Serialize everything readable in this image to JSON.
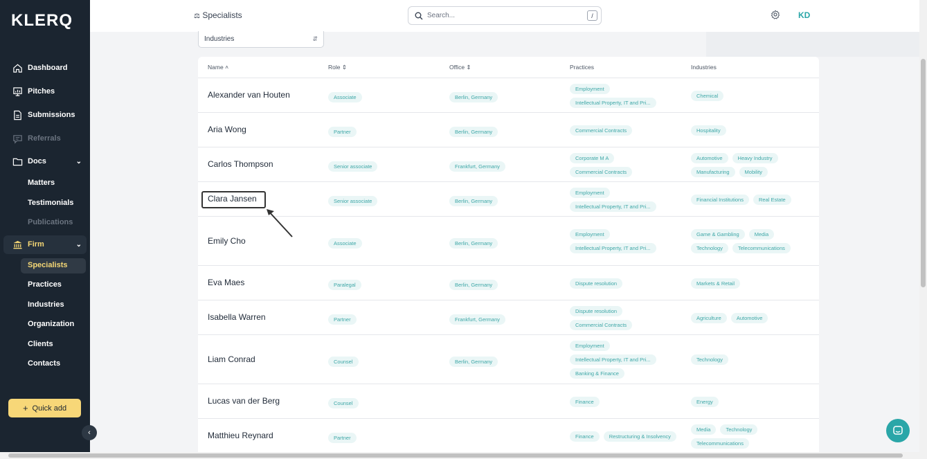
{
  "app": {
    "logo": "KLERQ"
  },
  "sidebar": {
    "items": [
      {
        "label": "Dashboard",
        "icon": "home-icon"
      },
      {
        "label": "Pitches",
        "icon": "presentation-icon"
      },
      {
        "label": "Submissions",
        "icon": "document-icon"
      },
      {
        "label": "Referrals",
        "icon": "chat-icon"
      },
      {
        "label": "Docs",
        "icon": "folder-icon"
      }
    ],
    "docs_sub": [
      "Matters",
      "Testimonials",
      "Publications"
    ],
    "firm_label": "Firm",
    "firm_sub": [
      "Specialists",
      "Practices",
      "Industries",
      "Organization",
      "Clients",
      "Contacts"
    ],
    "quick_add": "Quick add"
  },
  "header": {
    "title": "Specialists",
    "search_placeholder": "Search...",
    "search_shortcut": "/",
    "avatar": "KD"
  },
  "filter": {
    "label": "Industries"
  },
  "table": {
    "columns": [
      "Name",
      "Role",
      "Office",
      "Practices",
      "Industries"
    ],
    "rows": [
      {
        "name": "Alexander van Houten",
        "role": "Associate",
        "office": "Berlin, Germany",
        "practices": [
          "Employment",
          "Intellectual Property, IT and Pri..."
        ],
        "industries": [
          "Chemical"
        ]
      },
      {
        "name": "Aria Wong",
        "role": "Partner",
        "office": "Berlin, Germany",
        "practices": [
          "Commercial Contracts"
        ],
        "industries": [
          "Hospitality"
        ]
      },
      {
        "name": "Carlos Thompson",
        "role": "Senior associate",
        "office": "Frankfurt, Germany",
        "practices": [
          "Corporate M A",
          "Commercial Contracts"
        ],
        "industries": [
          "Automotive",
          "Heavy Industry",
          "Manufacturing",
          "Mobility"
        ]
      },
      {
        "name": "Clara Jansen",
        "role": "Senior associate",
        "office": "Berlin, Germany",
        "practices": [
          "Employment",
          "Intellectual Property, IT and Pri..."
        ],
        "industries": [
          "Financial Institutions",
          "Real Estate"
        ]
      },
      {
        "name": "Emily Cho",
        "role": "Associate",
        "office": "Berlin, Germany",
        "practices": [
          "Employment",
          "Intellectual Property, IT and Pri..."
        ],
        "industries": [
          "Game & Gambling",
          "Media",
          "Technology",
          "Telecommunications"
        ]
      },
      {
        "name": "Eva Maes",
        "role": "Paralegal",
        "office": "Berlin, Germany",
        "practices": [
          "Dispute resolution"
        ],
        "industries": [
          "Markets & Retail"
        ]
      },
      {
        "name": "Isabella Warren",
        "role": "Partner",
        "office": "Frankfurt, Germany",
        "practices": [
          "Dispute resolution",
          "Commercial Contracts"
        ],
        "industries": [
          "Agriculture",
          "Automotive"
        ]
      },
      {
        "name": "Liam Conrad",
        "role": "Counsel",
        "office": "Berlin, Germany",
        "practices": [
          "Employment",
          "Intellectual Property, IT and Pri...",
          "Banking & Finance"
        ],
        "industries": [
          "Technology"
        ]
      },
      {
        "name": "Lucas van der Berg",
        "role": "Counsel",
        "office": "",
        "practices": [
          "Finance"
        ],
        "industries": [
          "Energy"
        ]
      },
      {
        "name": "Matthieu Reynard",
        "role": "Partner",
        "office": "",
        "practices": [
          "Finance",
          "Restructuring & Insolvency"
        ],
        "industries": [
          "Media",
          "Technology",
          "Telecommunications"
        ]
      }
    ]
  },
  "colors": {
    "sidebar": "#1b2530",
    "accent": "#f5d775",
    "tag_text": "#3ea7a7",
    "tag_bg": "#eaf6f6"
  }
}
